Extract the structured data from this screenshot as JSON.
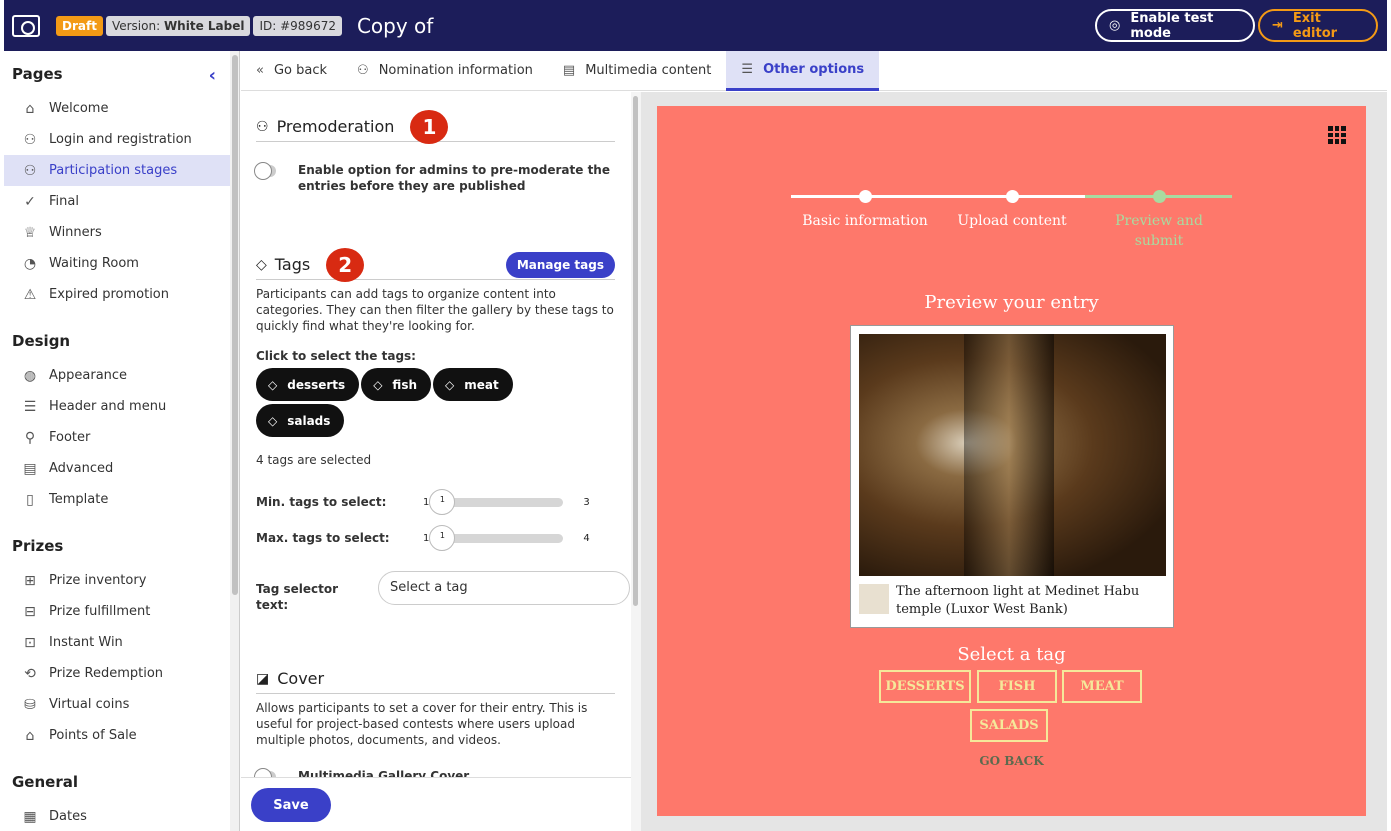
{
  "header": {
    "draft": "Draft",
    "version_label": "Version:",
    "version": "White Label",
    "id": "ID: #989672",
    "title": "Copy of",
    "test_mode": "Enable test mode",
    "exit": "Exit editor"
  },
  "sidebar": {
    "sections": [
      {
        "title": "Pages",
        "items": [
          {
            "label": "Welcome",
            "icon": "⌂"
          },
          {
            "label": "Login and registration",
            "icon": "⚇"
          },
          {
            "label": "Participation stages",
            "icon": "⚇",
            "active": true
          },
          {
            "label": "Final",
            "icon": "✓"
          },
          {
            "label": "Winners",
            "icon": "♕"
          },
          {
            "label": "Waiting Room",
            "icon": "◔"
          },
          {
            "label": "Expired promotion",
            "icon": "⚠"
          }
        ]
      },
      {
        "title": "Design",
        "items": [
          {
            "label": "Appearance",
            "icon": "◍"
          },
          {
            "label": "Header and menu",
            "icon": "☰"
          },
          {
            "label": "Footer",
            "icon": "⚲"
          },
          {
            "label": "Advanced",
            "icon": "▤"
          },
          {
            "label": "Template",
            "icon": "▯"
          }
        ]
      },
      {
        "title": "Prizes",
        "items": [
          {
            "label": "Prize inventory",
            "icon": "⊞"
          },
          {
            "label": "Prize fulfillment",
            "icon": "⊟"
          },
          {
            "label": "Instant Win",
            "icon": "⊡"
          },
          {
            "label": "Prize Redemption",
            "icon": "⟲"
          },
          {
            "label": "Virtual coins",
            "icon": "⛁"
          },
          {
            "label": "Points of Sale",
            "icon": "⌂"
          }
        ]
      },
      {
        "title": "General",
        "items": [
          {
            "label": "Dates",
            "icon": "▦"
          }
        ]
      }
    ]
  },
  "tabs": [
    {
      "label": "Go back",
      "icon": "«"
    },
    {
      "label": "Nomination information",
      "icon": "⚇"
    },
    {
      "label": "Multimedia content",
      "icon": "▤"
    },
    {
      "label": "Other options",
      "icon": "☰",
      "active": true
    }
  ],
  "premoderation": {
    "title": "Premoderation",
    "step": "1",
    "toggle_label": "Enable option for admins to pre-moderate the entries before they are published",
    "enabled": false
  },
  "tags": {
    "title": "Tags",
    "step": "2",
    "manage": "Manage tags",
    "description": "Participants can add tags to organize content into categories. They can then filter the gallery by these tags to quickly find what they're looking for.",
    "click_label": "Click to select the tags:",
    "chips": [
      "desserts",
      "fish",
      "meat",
      "salads"
    ],
    "count_text": "4 tags are selected",
    "min": {
      "label": "Min. tags to select:",
      "low": "1",
      "value": "1",
      "high": "3"
    },
    "max": {
      "label": "Max. tags to select:",
      "low": "1",
      "value": "1",
      "high": "4"
    },
    "selector_label": "Tag selector text:",
    "selector_value": "Select a tag"
  },
  "cover": {
    "title": "Cover",
    "description": "Allows participants to set a cover for their entry. This is useful for project-based contests where users upload multiple photos, documents, and videos.",
    "toggle_label": "Multimedia Gallery Cover"
  },
  "footer": {
    "save": "Save"
  },
  "preview": {
    "steps": [
      "Basic information",
      "Upload content",
      "Preview and submit"
    ],
    "current_step": 3,
    "heading": "Preview your entry",
    "caption": "The afternoon light at Medinet Habu temple (Luxor West Bank)",
    "select_heading": "Select a tag",
    "tag_buttons": [
      "DESSERTS",
      "FISH",
      "MEAT",
      "SALADS"
    ],
    "go_back": "GO BACK",
    "colors": {
      "background": "#fe786b",
      "active_step": "#a8dba0",
      "tag_border": "#f5e89a"
    }
  }
}
